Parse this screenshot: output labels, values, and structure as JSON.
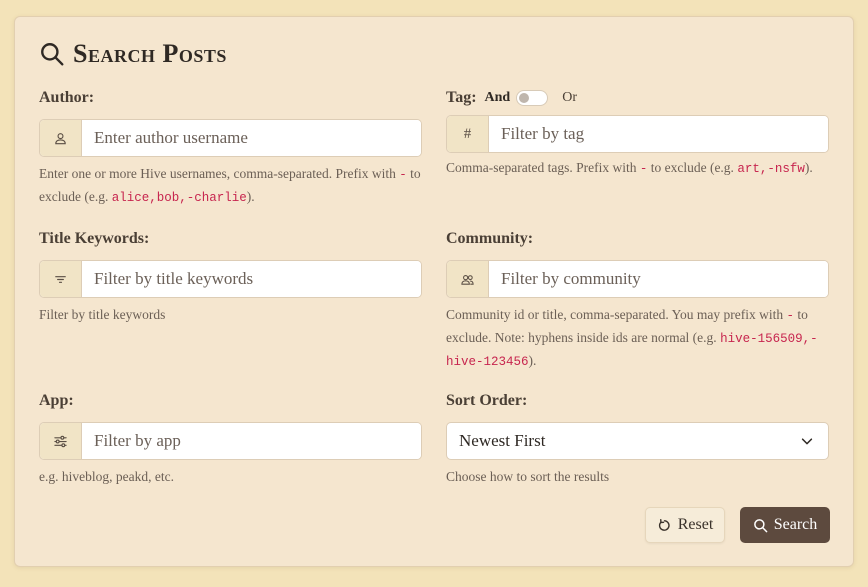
{
  "header": {
    "title": "Search Posts",
    "icon": "search-icon"
  },
  "author": {
    "label": "Author:",
    "icon": "user-icon",
    "placeholder": "Enter author username",
    "value": "",
    "help_pre": "Enter one or more Hive usernames, comma-separated. Prefix with ",
    "help_code1": "-",
    "help_mid": " to exclude (e.g. ",
    "help_code2": "alice,bob,-charlie",
    "help_post": ")."
  },
  "tag": {
    "label": "Tag:",
    "toggle_and": "And",
    "toggle_or": "Or",
    "icon": "hash-icon",
    "addon_text": "#",
    "placeholder": "Filter by tag",
    "value": "",
    "help_pre": "Comma-separated tags. Prefix with ",
    "help_code1": "-",
    "help_mid": " to exclude (e.g. ",
    "help_code2": "art,-nsfw",
    "help_post": ")."
  },
  "title_keywords": {
    "label": "Title Keywords:",
    "icon": "filter-icon",
    "placeholder": "Filter by title keywords",
    "value": "",
    "help": "Filter by title keywords"
  },
  "community": {
    "label": "Community:",
    "icon": "people-icon",
    "placeholder": "Filter by community",
    "value": "",
    "help_pre": "Community id or title, comma-separated. You may prefix with ",
    "help_code1": "-",
    "help_mid": " to exclude. Note: hyphens inside ids are normal (e.g. ",
    "help_code2": "hive-156509,-hive-123456",
    "help_post": ")."
  },
  "app": {
    "label": "App:",
    "icon": "sliders-icon",
    "placeholder": "Filter by app",
    "value": "",
    "help": "e.g. hiveblog, peakd, etc."
  },
  "sort": {
    "label": "Sort Order:",
    "selected": "Newest First",
    "help": "Choose how to sort the results"
  },
  "actions": {
    "reset_label": "Reset",
    "search_label": "Search"
  },
  "colors": {
    "page_bg": "#f3e3b9",
    "card_bg": "#f5e6cf",
    "addon_bg": "#f1e4c6",
    "primary_button": "#5d4a3e",
    "code_text": "#c7254e"
  }
}
